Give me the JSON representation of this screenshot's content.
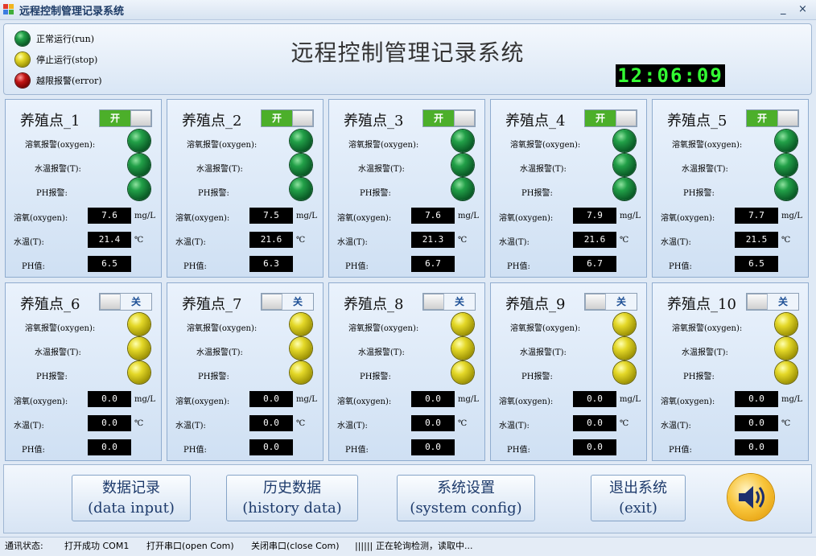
{
  "window": {
    "title": "远程控制管理记录系统",
    "minimize": "_",
    "close": "×"
  },
  "header": {
    "title": "远程控制管理记录系统",
    "clock": "12:06:09",
    "legend": [
      {
        "label": "正常运行(run)",
        "color": "green"
      },
      {
        "label": "停止运行(stop)",
        "color": "yellow"
      },
      {
        "label": "越限报警(error)",
        "color": "red"
      }
    ]
  },
  "labels": {
    "oxygen_alarm": "溶氧报警(oxygen):",
    "temp_alarm": "水温报警(T):",
    "ph_alarm": "PH报警:",
    "oxygen": "溶氧(oxygen):",
    "temp": "水温(T):",
    "ph": "PH值:",
    "oxygen_unit": "mg/L",
    "temp_unit": "℃",
    "on": "开",
    "off": "关"
  },
  "stations": [
    {
      "name": "养殖点_1",
      "switch": "on",
      "led": "green",
      "oxygen": "7.6",
      "temp": "21.4",
      "ph": "6.5"
    },
    {
      "name": "养殖点_2",
      "switch": "on",
      "led": "green",
      "oxygen": "7.5",
      "temp": "21.6",
      "ph": "6.3"
    },
    {
      "name": "养殖点_3",
      "switch": "on",
      "led": "green",
      "oxygen": "7.6",
      "temp": "21.3",
      "ph": "6.7"
    },
    {
      "name": "养殖点_4",
      "switch": "on",
      "led": "green",
      "oxygen": "7.9",
      "temp": "21.6",
      "ph": "6.7"
    },
    {
      "name": "养殖点_5",
      "switch": "on",
      "led": "green",
      "oxygen": "7.7",
      "temp": "21.5",
      "ph": "6.5"
    },
    {
      "name": "养殖点_6",
      "switch": "off",
      "led": "yellow",
      "oxygen": "0.0",
      "temp": "0.0",
      "ph": "0.0"
    },
    {
      "name": "养殖点_7",
      "switch": "off",
      "led": "yellow",
      "oxygen": "0.0",
      "temp": "0.0",
      "ph": "0.0"
    },
    {
      "name": "养殖点_8",
      "switch": "off",
      "led": "yellow",
      "oxygen": "0.0",
      "temp": "0.0",
      "ph": "0.0"
    },
    {
      "name": "养殖点_9",
      "switch": "off",
      "led": "yellow",
      "oxygen": "0.0",
      "temp": "0.0",
      "ph": "0.0"
    },
    {
      "name": "养殖点_10",
      "switch": "off",
      "led": "yellow",
      "oxygen": "0.0",
      "temp": "0.0",
      "ph": "0.0"
    }
  ],
  "buttons": [
    {
      "line1": "数据记录",
      "line2": "(data input)"
    },
    {
      "line1": "历史数据",
      "line2": "(history data)"
    },
    {
      "line1": "系统设置",
      "line2": "(system config)"
    },
    {
      "line1": "退出系统",
      "line2": "(exit)"
    }
  ],
  "status": {
    "label": "通讯状态:",
    "open_ok": "打开成功 COM1",
    "open_port": "打开串口(open Com)",
    "close_port": "关闭串口(close Com)",
    "bars": "||||||",
    "polling": "正在轮询检测，读取中..."
  }
}
